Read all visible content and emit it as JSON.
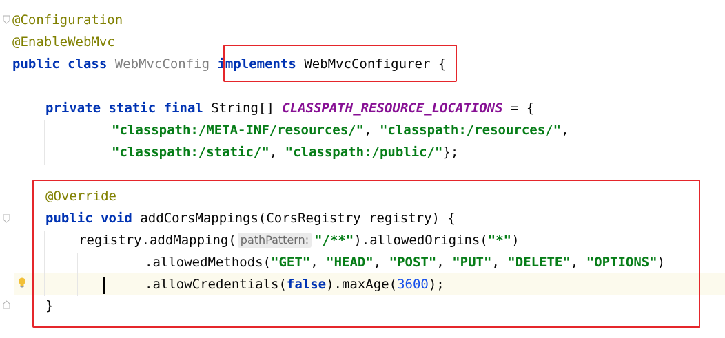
{
  "code": {
    "l1_annotation": "@Configuration",
    "l2_annotation": "@EnableWebMvc",
    "l3_kw1": "public",
    "l3_kw2": "class",
    "l3_classname": "WebMvcConfig",
    "l3_kw3": "implements",
    "l3_iface": "WebMvcConfigurer",
    "l3_brace": "{",
    "l5_kw1": "private",
    "l5_kw2": "static",
    "l5_kw3": "final",
    "l5_type": "String[]",
    "l5_const": "CLASSPATH_RESOURCE_LOCATIONS",
    "l5_eq": "= {",
    "l6_str1": "\"classpath:/META-INF/resources/\"",
    "l6_sep": ", ",
    "l6_str2": "\"classpath:/resources/\"",
    "l6_end": ",",
    "l7_str1": "\"classpath:/static/\"",
    "l7_sep": ", ",
    "l7_str2": "\"classpath:/public/\"",
    "l7_end": "};",
    "l9_annotation": "@Override",
    "l10_kw1": "public",
    "l10_kw2": "void",
    "l10_rest": "addCorsMappings(CorsRegistry registry) {",
    "l11_pre": "registry.addMapping(",
    "l11_hint": "pathPattern:",
    "l11_str": "\"/**\"",
    "l11_mid": ").allowedOrigins(",
    "l11_str2": "\"*\"",
    "l11_end": ")",
    "l12_pre": ".allowedMethods(",
    "l12_s1": "\"GET\"",
    "l12_s2": "\"HEAD\"",
    "l12_s3": "\"POST\"",
    "l12_s4": "\"PUT\"",
    "l12_s5": "\"DELETE\"",
    "l12_s6": "\"OPTIONS\"",
    "l12_sep": ", ",
    "l12_end": ")",
    "l13_pre": ".allowCredentials(",
    "l13_false": "false",
    "l13_mid": ").maxAge(",
    "l13_num": "3600",
    "l13_end": ");",
    "l14_brace": "}"
  },
  "colors": {
    "annotation": "#808000",
    "keyword": "#0033b3",
    "string": "#067d17",
    "constant": "#871094",
    "number": "#1750eb",
    "highlight_box": "#e5262b"
  }
}
